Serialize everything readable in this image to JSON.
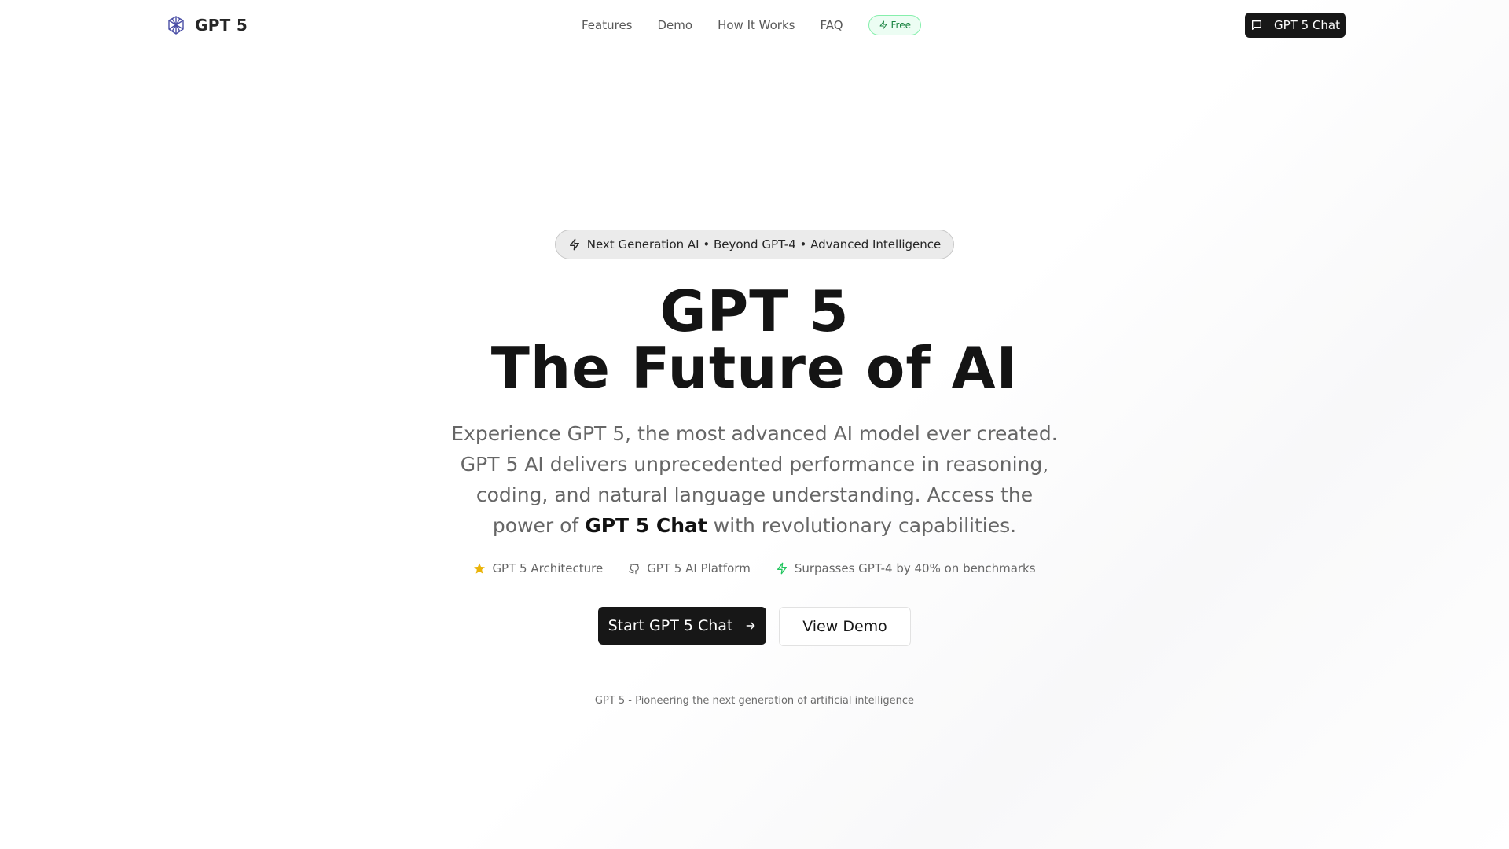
{
  "nav": {
    "brand": "GPT 5",
    "links": [
      "Features",
      "Demo",
      "How It Works",
      "FAQ"
    ],
    "free_badge": "Free",
    "chat_button": "GPT 5 Chat"
  },
  "hero": {
    "pill": "Next Generation AI • Beyond GPT-4 • Advanced Intelligence",
    "headline_line1": "GPT 5",
    "headline_line2": "The Future of AI",
    "subtitle_before": "Experience GPT 5, the most advanced AI model ever created. GPT 5 AI delivers unprecedented performance in reasoning, coding, and natural language understanding. Access the power of ",
    "subtitle_bold": "GPT 5 Chat",
    "subtitle_after": " with revolutionary capabilities.",
    "features": [
      {
        "icon": "star-icon",
        "label": "GPT 5 Architecture",
        "color": "#eab308"
      },
      {
        "icon": "github-icon",
        "label": "GPT 5 AI Platform",
        "color": "#666666"
      },
      {
        "icon": "zap-icon",
        "label": "Surpasses GPT-4 by 40% on benchmarks",
        "color": "#22c55e"
      }
    ],
    "primary_cta": "Start GPT 5 Chat",
    "secondary_cta": "View Demo",
    "tagline": "GPT 5 - Pioneering the next generation of artificial intelligence"
  },
  "colors": {
    "primary": "#171717",
    "muted_text": "#666666",
    "free_badge_green": "#15803d"
  }
}
